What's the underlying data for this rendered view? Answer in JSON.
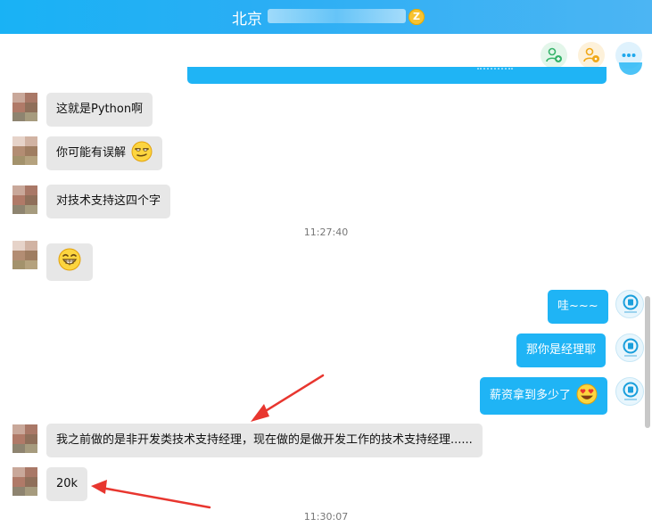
{
  "header": {
    "title": "北京",
    "vip_badge": "Z",
    "actions": [
      {
        "name": "add-member",
        "icon": "person-add-icon",
        "color": "#36b36a"
      },
      {
        "name": "profile",
        "icon": "person-settings-icon",
        "color": "#f0a818"
      },
      {
        "name": "more",
        "icon": "more-icon",
        "color": "#1fa8ec"
      }
    ]
  },
  "messages": [
    {
      "side": "left",
      "text": "这就是Python啊"
    },
    {
      "side": "left",
      "text": "你可能有误解",
      "emoji": "smirk-emoji"
    },
    {
      "side": "left",
      "text": "对技术支持这四个字"
    },
    {
      "time": "11:27:40"
    },
    {
      "side": "left",
      "text": "",
      "emoji": "grin-emoji"
    },
    {
      "side": "right",
      "text": "哇~~~"
    },
    {
      "side": "right",
      "text": "那你是经理耶"
    },
    {
      "side": "right",
      "text": "薪资拿到多少了",
      "emoji": "heart-eyes-emoji"
    },
    {
      "side": "left",
      "text": "我之前做的是非开发类技术支持经理，现在做的是做开发工作的技术支持经理......"
    },
    {
      "side": "left",
      "text": "20k"
    },
    {
      "time": "11:30:07"
    }
  ],
  "colors": {
    "header_bg": "#19b2f5",
    "bubble_self": "#1fb4f5",
    "bubble_other": "#e7e7e7",
    "annotation_arrow": "#e8362f"
  }
}
